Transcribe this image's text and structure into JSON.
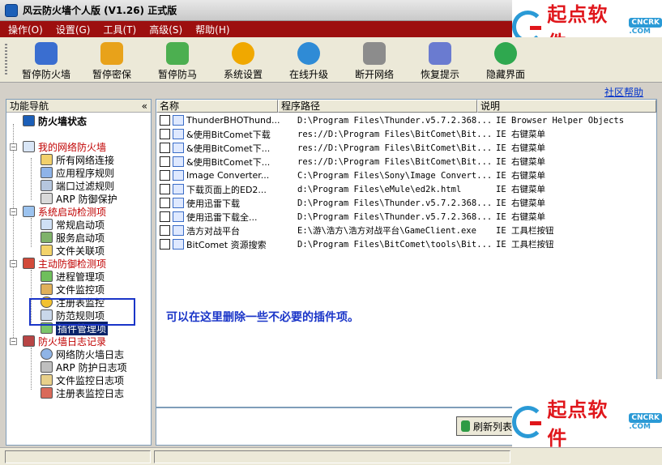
{
  "window": {
    "title": "风云防火墙个人版 (V1.26) 正式版"
  },
  "menu": [
    "操作(O)",
    "设置(G)",
    "工具(T)",
    "高级(S)",
    "帮助(H)"
  ],
  "logo": {
    "text": "起点软件",
    "badge": "CNCRK",
    "domain": ".COM"
  },
  "toolbar": [
    {
      "label": "暂停防火墙",
      "icon": "firewall-pause-icon",
      "color": "#3a6ed0"
    },
    {
      "label": "暂停密保",
      "icon": "password-protect-icon",
      "color": "#e8a21a"
    },
    {
      "label": "暂停防马",
      "icon": "shield-icon",
      "color": "#4caf50"
    },
    {
      "label": "系统设置",
      "icon": "gear-icon",
      "color": "#f0a800"
    },
    {
      "label": "在线升级",
      "icon": "globe-update-icon",
      "color": "#2f8bd6"
    },
    {
      "label": "断开网络",
      "icon": "network-disconnect-icon",
      "color": "#8c8c8c"
    },
    {
      "label": "恢复提示",
      "icon": "restore-hint-icon",
      "color": "#6a7bd0"
    },
    {
      "label": "隐藏界面",
      "icon": "hide-window-icon",
      "color": "#2fa84f"
    }
  ],
  "community_link": "社区帮助",
  "nav": {
    "header": "功能导航",
    "collapse": "«",
    "items": [
      {
        "label": "防火墙状态",
        "level": 0,
        "style": "bold"
      },
      {
        "label": "我的网络防火墙",
        "level": 0,
        "style": "red"
      },
      {
        "label": "所有网络连接",
        "level": 1
      },
      {
        "label": "应用程序规则",
        "level": 1
      },
      {
        "label": "端口过滤规则",
        "level": 1
      },
      {
        "label": "ARP 防御保护",
        "level": 1
      },
      {
        "label": "系统启动检测项",
        "level": 0,
        "style": "red"
      },
      {
        "label": "常规启动项",
        "level": 1
      },
      {
        "label": "服务启动项",
        "level": 1
      },
      {
        "label": "文件关联项",
        "level": 1
      },
      {
        "label": "主动防御检测项",
        "level": 0,
        "style": "red"
      },
      {
        "label": "进程管理项",
        "level": 1
      },
      {
        "label": "文件监控项",
        "level": 1
      },
      {
        "label": "注册表监控",
        "level": 1
      },
      {
        "label": "防范规则项",
        "level": 1
      },
      {
        "label": "插件管理项",
        "level": 1,
        "selected": true
      },
      {
        "label": "防火墙日志记录",
        "level": 0,
        "style": "red"
      },
      {
        "label": "网络防火墙日志",
        "level": 1
      },
      {
        "label": "ARP 防护日志项",
        "level": 1
      },
      {
        "label": "文件监控日志项",
        "level": 1
      },
      {
        "label": "注册表监控日志",
        "level": 1
      }
    ]
  },
  "list": {
    "columns": [
      "名称",
      "程序路径",
      "说明"
    ],
    "rows": [
      {
        "name": "ThunderBHOThund...",
        "path": "D:\\Program Files\\Thunder.v5.7.2.368...",
        "desc": "IE Browser Helper Objects"
      },
      {
        "name": "&使用BitComet下载",
        "path": "res://D:\\Program Files\\BitComet\\Bit...",
        "desc": "IE 右键菜单"
      },
      {
        "name": "&使用BitComet下...",
        "path": "res://D:\\Program Files\\BitComet\\Bit...",
        "desc": "IE 右键菜单"
      },
      {
        "name": "&使用BitComet下...",
        "path": "res://D:\\Program Files\\BitComet\\Bit...",
        "desc": "IE 右键菜单"
      },
      {
        "name": "Image Converter...",
        "path": "C:\\Program Files\\Sony\\Image Convert...",
        "desc": "IE 右键菜单"
      },
      {
        "name": "下载页面上的ED2...",
        "path": "d:\\Program Files\\eMule\\ed2k.html",
        "desc": "IE 右键菜单"
      },
      {
        "name": "使用迅雷下载",
        "path": "D:\\Program Files\\Thunder.v5.7.2.368...",
        "desc": "IE 右键菜单"
      },
      {
        "name": "使用迅雷下载全...",
        "path": "D:\\Program Files\\Thunder.v5.7.2.368...",
        "desc": "IE 右键菜单"
      },
      {
        "name": "浩方对战平台",
        "path": "E:\\游\\浩方\\浩方对战平台\\GameClient.exe",
        "desc": "IE 工具栏按钮"
      },
      {
        "name": "BitComet 资源搜索",
        "path": "D:\\Program Files\\BitComet\\tools\\Bit...",
        "desc": "IE 工具栏按钮"
      }
    ]
  },
  "annotation": "可以在这里删除一些不必要的插件项。",
  "refresh_button": "刷新列表"
}
